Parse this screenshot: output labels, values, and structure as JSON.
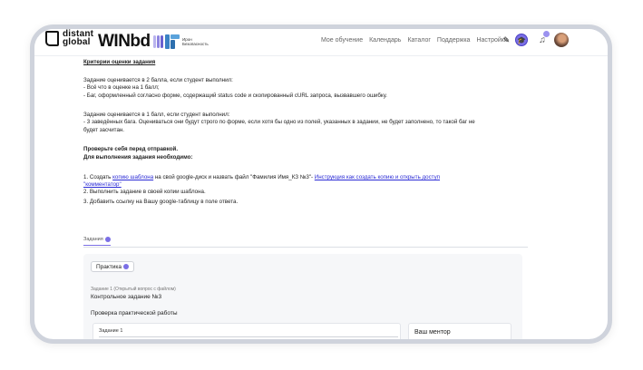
{
  "header": {
    "logo_da_line1": "distant",
    "logo_da_line2": "global",
    "logo_winbd": "WINbd",
    "logo_ib_line1": "Ирон",
    "logo_ib_line2": "Безопасность",
    "nav": [
      "Мое обучение",
      "Календарь",
      "Каталог",
      "Поддержка",
      "Настройки"
    ]
  },
  "content": {
    "heading": "Критерии оценки задания",
    "lines": [
      "Задание оценивается в 2 балла, если студент выполнил:",
      "- Всё что в оценке на 1 балл;",
      "- Баг, оформленный согласно форме, содержащий status code и скопированный cURL запроса, вызвавшего ошибку.",
      "Задание оценивается в 1 балл, если студент выполнил:",
      "- 3 заведённых бага. Оцениваться они будут строго по форме, если хотя бы одно из полей, указанных в задании, не будет заполнено, то такой баг не",
      "будет засчитан."
    ],
    "bold1": "Проверьте себя перед отправкой.",
    "bold2": "Для выполнения задания необходимо:",
    "step1_prefix": "1. Создать ",
    "step1_link1": "копию шаблона",
    "step1_middle": " на свой google-диск и назвать файл \"Фамилия Имя_КЗ №3\"- ",
    "step1_link2": "Инструкция как создать копию и открыть доступ",
    "step1_link3": "\"комментатор\"",
    "step2": "2. Выполнить задание в своей копии шаблона.",
    "step3": "3. Добавить ссылку на Вашу google-таблицу в поле ответа."
  },
  "tabs": {
    "tasks_label": "Задания"
  },
  "card": {
    "practice_label": "Практика",
    "meta": "Задание 1 (Открытый вопрос с файлом)",
    "control": "Контрольное задание №3",
    "check": "Проверка практической работы",
    "sub_title": "Задание 1",
    "mentor": "Ваш ментор"
  },
  "colors": {
    "accent": "#7b6fe6",
    "link": "#2b2bd6"
  }
}
